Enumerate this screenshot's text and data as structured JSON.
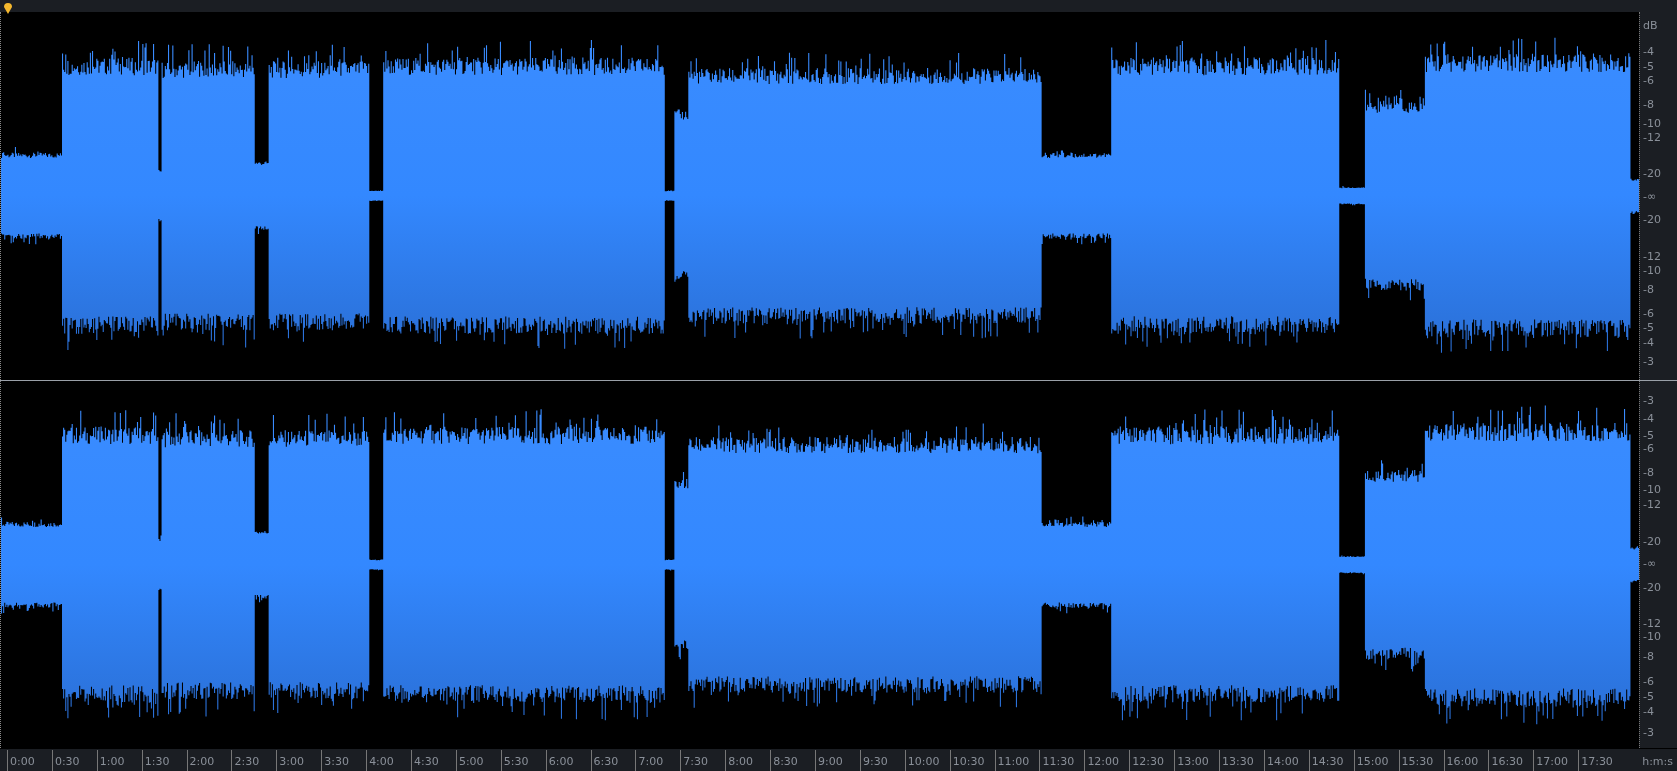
{
  "channels": [
    {
      "scale": {
        "unit": "dB",
        "ticks": [
          "-4",
          "-5",
          "-6",
          "-8",
          "-10",
          "-12",
          "-20",
          "-∞",
          "-20",
          "-12",
          "-10",
          "-8",
          "-6",
          "-5",
          "-4",
          "-3"
        ]
      }
    },
    {
      "scale": {
        "ticks": [
          "-3",
          "-4",
          "-5",
          "-6",
          "-8",
          "-10",
          "-12",
          "-20",
          "-∞",
          "-20",
          "-12",
          "-10",
          "-8",
          "-6",
          "-5",
          "-4",
          "-3"
        ]
      }
    }
  ],
  "time_ruler": {
    "labels": [
      "0:00",
      "0:30",
      "1:00",
      "1:30",
      "2:00",
      "2:30",
      "3:00",
      "3:30",
      "4:00",
      "4:30",
      "5:00",
      "5:30",
      "6:00",
      "6:30",
      "7:00",
      "7:30",
      "8:00",
      "8:30",
      "9:00",
      "9:30",
      "10:00",
      "10:30",
      "11:00",
      "11:30",
      "12:00",
      "12:30",
      "13:00",
      "13:30",
      "14:00",
      "14:30",
      "15:00",
      "15:30",
      "16:00",
      "16:30",
      "17:00",
      "17:30"
    ],
    "unit": "h:m:s"
  }
}
